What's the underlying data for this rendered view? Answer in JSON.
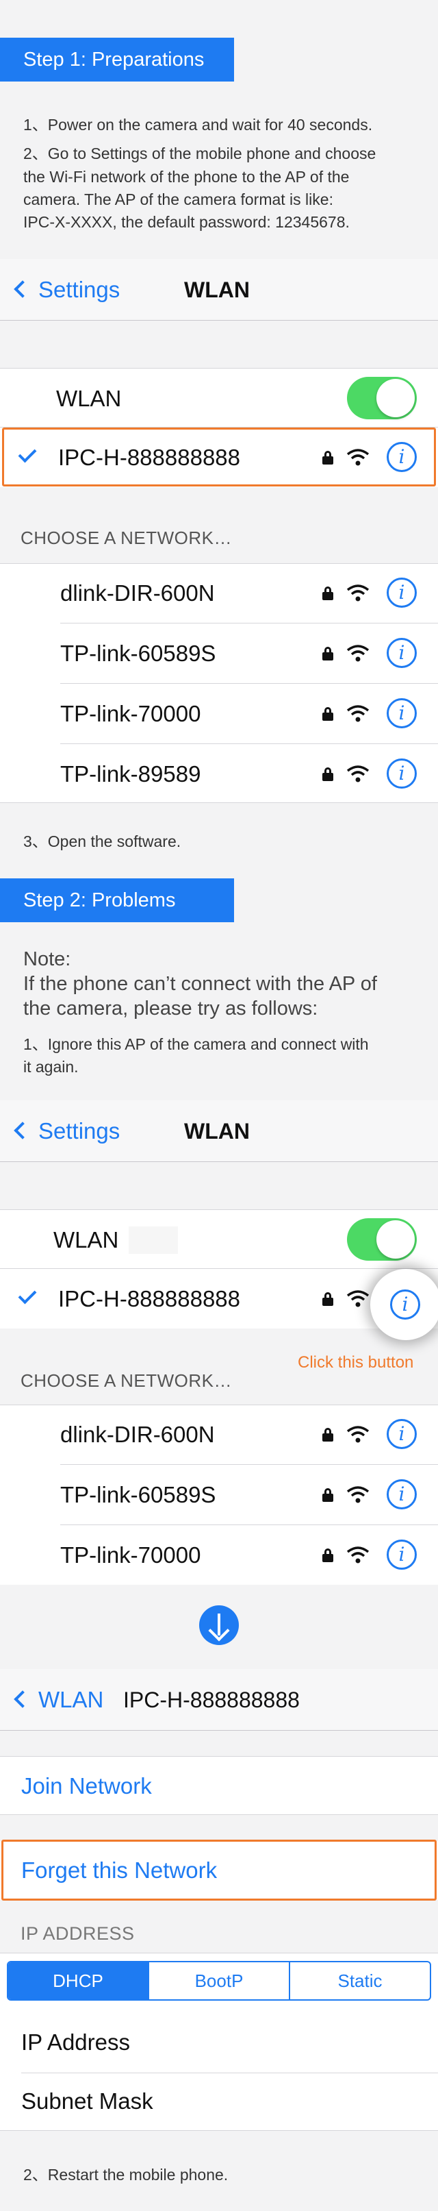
{
  "step1": {
    "banner": "Step 1: Preparations",
    "line1": "1、Power on the camera and wait for 40 seconds.",
    "line2a": "2、Go to Settings of the mobile phone and choose",
    "line2b": "the Wi-Fi network of the phone to the AP of the",
    "line2c": "camera. The AP of the camera format is like:",
    "line2d": "IPC-X-XXXX, the default password: 12345678."
  },
  "screen1": {
    "back_label": "Settings",
    "title": "WLAN",
    "wlan_label": "WLAN",
    "connected_network": "IPC-H-888888888",
    "section_header": "CHOOSE A NETWORK…",
    "networks": [
      "dlink-DIR-600N",
      "TP-link-60589S",
      "TP-link-70000",
      "TP-link-89589"
    ]
  },
  "step1_after": "3、Open the software.",
  "step2": {
    "banner": "Step 2: Problems",
    "note_title": "Note:",
    "note_line1": "If the phone can’t connect with the AP of",
    "note_line2": "the camera, please try as follows:",
    "tip_line1": "1、Ignore this AP of the camera and connect with",
    "tip_line2": "it again."
  },
  "screen2": {
    "back_label": "Settings",
    "title": "WLAN",
    "wlan_label": "WLAN",
    "connected_network": "IPC-H-888888888",
    "click_hint": "Click this button",
    "section_header": "CHOOSE A NETWORK…",
    "networks": [
      "dlink-DIR-600N",
      "TP-link-60589S",
      "TP-link-70000"
    ]
  },
  "screen3": {
    "back_label": "WLAN",
    "title": "IPC-H-888888888",
    "join_label": "Join Network",
    "forget_label": "Forget this Network",
    "ip_header": "IP ADDRESS",
    "segments": [
      "DHCP",
      "BootP",
      "Static"
    ],
    "ip_address_label": "IP Address",
    "subnet_label": "Subnet Mask"
  },
  "final_tip": "2、Restart the mobile phone.",
  "colors": {
    "accent": "#1e7bf2",
    "toggle_on": "#4cd964",
    "highlight": "#f07a2c"
  }
}
